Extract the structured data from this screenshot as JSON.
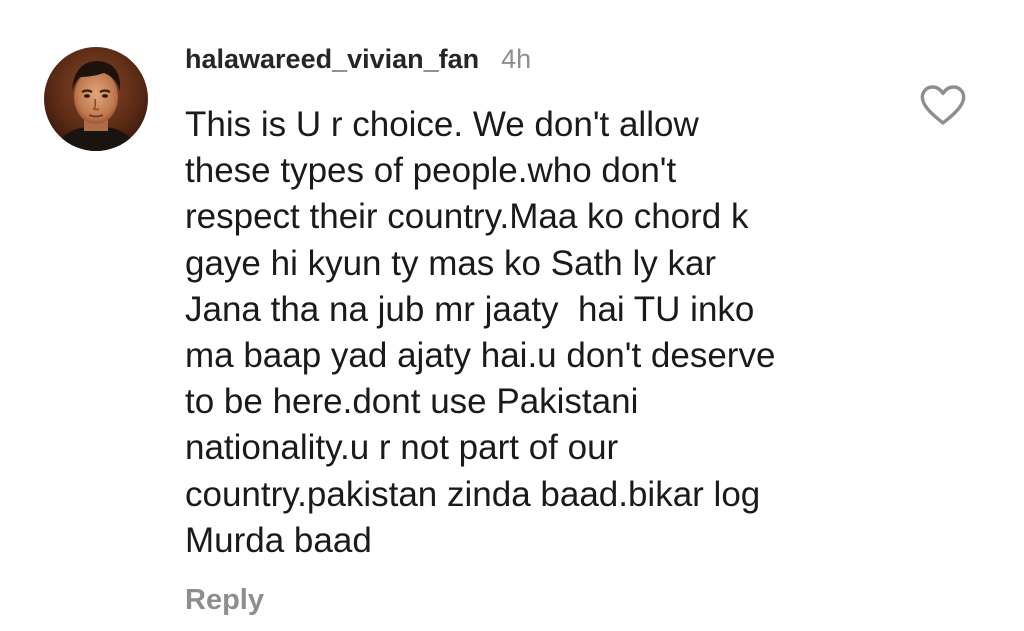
{
  "comment": {
    "username": "halawareed_vivian_fan",
    "time": "4h",
    "lines": [
      "This is U r choice. We don't allow",
      "these types of people.who don't",
      "respect their country.Maa ko chord k",
      "gaye hi kyun ty mas ko Sath ly kar",
      "Jana tha na jub mr jaaty  hai TU inko",
      "ma baap yad ajaty hai.u don't deserve",
      "to be here.dont use Pakistani",
      "nationality.u r not part of our",
      "country.pakistan zinda baad.bikar log",
      "Murda baad"
    ],
    "reply_label": "Reply",
    "like_icon": "heart-outline-icon",
    "avatar_icon": "profile-photo-avatar"
  },
  "colors": {
    "text": "#1a1a1a",
    "username": "#262626",
    "muted": "#8e8e8e",
    "background": "#ffffff"
  }
}
